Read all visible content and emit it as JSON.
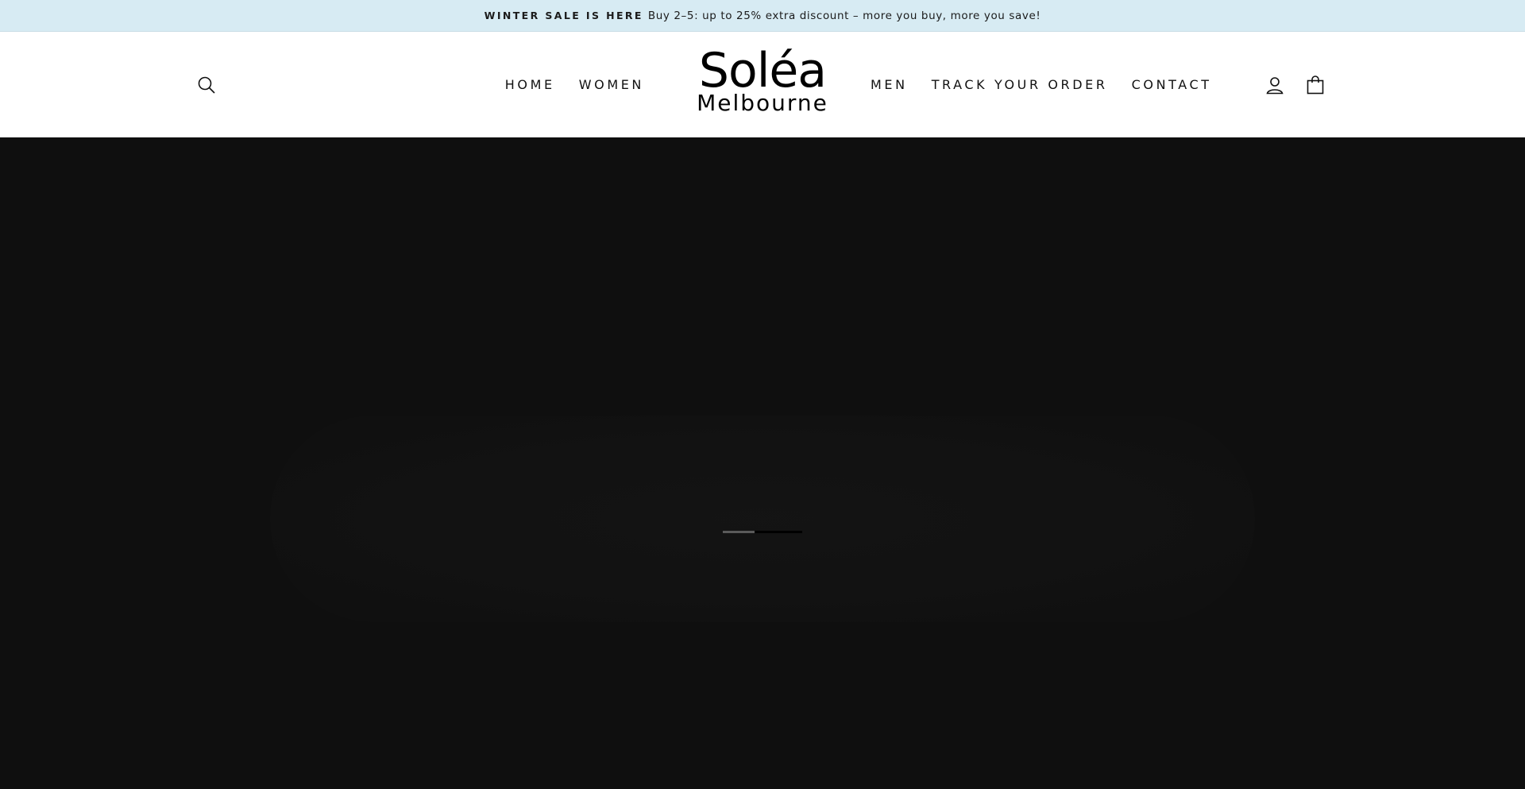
{
  "announcement": {
    "highlight": "WINTER SALE IS HERE",
    "text": "Buy 2–5: up to 25% extra discount – more you buy, more you save!"
  },
  "header": {
    "logo": {
      "brand": "Soléa",
      "city": "Melbourne"
    },
    "nav_left": [
      "HOME",
      "WOMEN"
    ],
    "nav_right": [
      "MEN",
      "TRACK YOUR ORDER",
      "CONTACT"
    ],
    "icons": {
      "search": "search-icon",
      "account": "user-icon",
      "cart": "bag-icon"
    }
  },
  "hero": {
    "slides": 2,
    "active_slide": 1
  },
  "colors": {
    "announcement_bg": "#d7ebf3",
    "header_bg": "#ffffff",
    "hero_bg": "#0f0f0f",
    "text": "#111111"
  }
}
